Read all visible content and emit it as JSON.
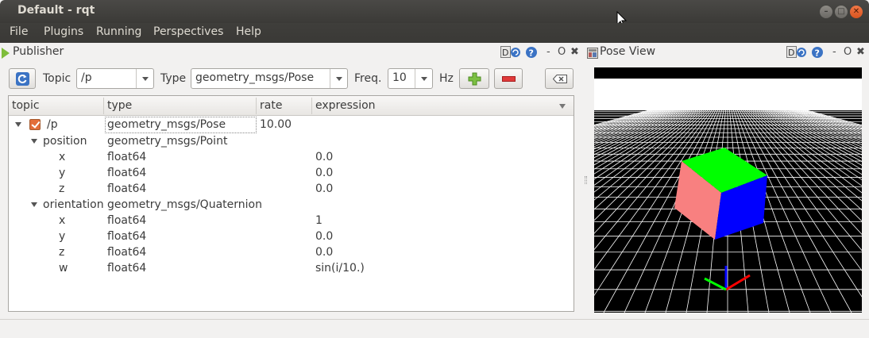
{
  "window": {
    "title": "Default - rqt",
    "controls": [
      "–",
      "□",
      "✕"
    ]
  },
  "menu": [
    "File",
    "Plugins",
    "Running",
    "Perspectives",
    "Help"
  ],
  "publisher": {
    "title": "Publisher",
    "dock_controls": {
      "dc": "D",
      "help": "?",
      "minimize": "-",
      "float": "O",
      "close": "✖"
    },
    "toolbar": {
      "topic_label": "Topic",
      "topic_value": "/p",
      "type_label": "Type",
      "type_value": "geometry_msgs/Pose",
      "freq_label": "Freq.",
      "freq_value": "10",
      "hz_label": "Hz"
    },
    "columns": [
      "topic",
      "type",
      "rate",
      "expression"
    ],
    "rows": [
      {
        "topic": "/p",
        "type": "geometry_msgs/Pose",
        "rate": "10.00",
        "expression": ""
      },
      {
        "topic": "position",
        "type": "geometry_msgs/Point",
        "rate": "",
        "expression": ""
      },
      {
        "topic": "x",
        "type": "float64",
        "rate": "",
        "expression": "0.0"
      },
      {
        "topic": "y",
        "type": "float64",
        "rate": "",
        "expression": "0.0"
      },
      {
        "topic": "z",
        "type": "float64",
        "rate": "",
        "expression": "0.0"
      },
      {
        "topic": "orientation",
        "type": "geometry_msgs/Quaternion",
        "rate": "",
        "expression": ""
      },
      {
        "topic": "x",
        "type": "float64",
        "rate": "",
        "expression": "1"
      },
      {
        "topic": "y",
        "type": "float64",
        "rate": "",
        "expression": "0.0"
      },
      {
        "topic": "z",
        "type": "float64",
        "rate": "",
        "expression": "0.0"
      },
      {
        "topic": "w",
        "type": "float64",
        "rate": "",
        "expression": "sin(i/10.)"
      }
    ]
  },
  "pose_view": {
    "title": "Pose View",
    "dock_controls": {
      "minimize": "-",
      "float": "O",
      "close": "✖"
    },
    "cube_colors": {
      "top": "#00ff00",
      "front": "#f88080",
      "right": "#0000ff"
    }
  },
  "colors": {
    "add": "#7cc043",
    "remove": "#e03a3a",
    "refresh": "#3b73c4"
  }
}
